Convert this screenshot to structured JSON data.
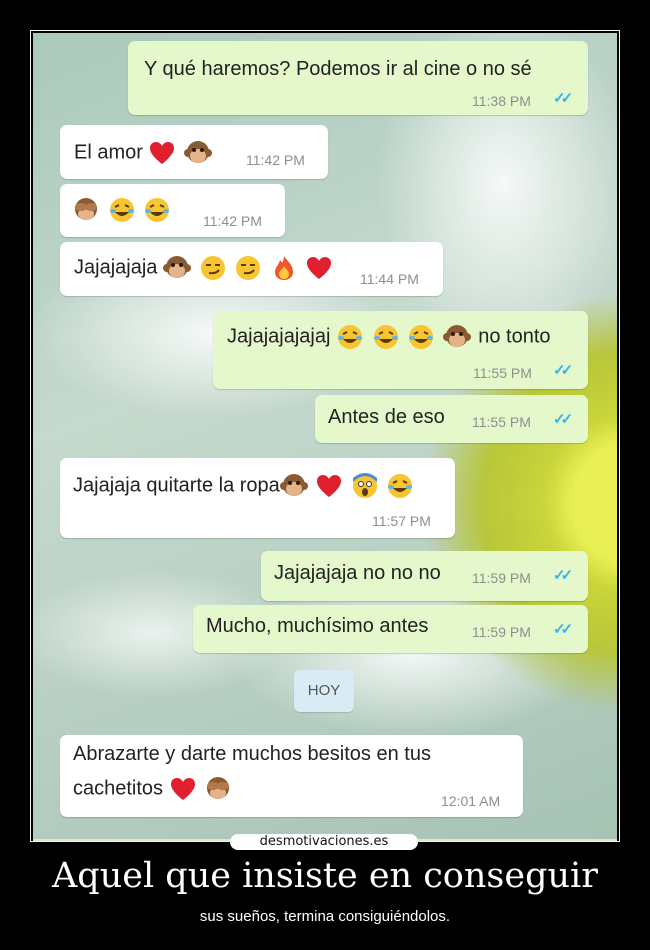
{
  "messages": [
    {
      "text": "Y qué haremos? Podemos ir al cine o no sé",
      "time": "11:38 PM",
      "emojis": []
    },
    {
      "text": "El amor",
      "time": "11:42 PM",
      "emojis": [
        "heart",
        "monkey"
      ]
    },
    {
      "text": "",
      "time": "11:42 PM",
      "emojis": [
        "see-no-evil-monkey",
        "joy",
        "joy"
      ]
    },
    {
      "text": "Jajajajaja",
      "time": "11:44 PM",
      "emojis": [
        "monkey",
        "smirk",
        "smirk",
        "fire",
        "heart"
      ]
    },
    {
      "text": "Jajajajajajaj",
      "time": "11:55 PM",
      "emojis": [
        "joy",
        "joy",
        "joy",
        "monkey"
      ],
      "text_after": "no tonto"
    },
    {
      "text": "Antes de eso",
      "time": "11:55 PM",
      "emojis": []
    },
    {
      "text": "Jajajaja quitarte la ropa",
      "time": "11:57 PM",
      "emojis": [
        "monkey",
        "heart",
        "scream",
        "joy"
      ]
    },
    {
      "text": "Jajajajaja no no no",
      "time": "11:59 PM",
      "emojis": []
    },
    {
      "text": "Mucho, muchísimo antes",
      "time": "11:59 PM",
      "emojis": []
    },
    {
      "text_line1": "Abrazarte y darte muchos besitos en tus",
      "text_line2": "cachetitos",
      "time": "12:01 AM",
      "emojis": [
        "heart",
        "see-no-evil-monkey"
      ]
    }
  ],
  "date_chip": "HOY",
  "read_ticks": "✓✓",
  "brand": "desmotivaciones.es",
  "caption": {
    "title": "Aquel que insiste en conseguir",
    "subtitle": "sus sueños, termina consiguiéndolos."
  },
  "colors": {
    "incoming_bubble": "#ffffff",
    "outgoing_bubble": "#e5f8cb",
    "read_tick": "#3bb2ec",
    "background": "#000000"
  }
}
